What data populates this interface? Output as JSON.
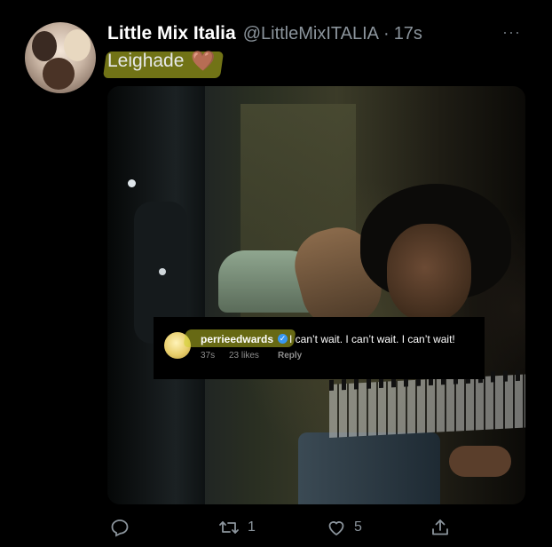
{
  "tweet": {
    "display_name": "Little Mix Italia",
    "handle": "@LittleMixITALIA",
    "separator": "·",
    "time": "17s",
    "more_icon": "···",
    "text": "Leighade",
    "emoji": "🤎"
  },
  "media": {
    "comment": {
      "username": "perrieedwards",
      "verified_icon": "✓",
      "text": "I can’t wait. I can’t wait. I can’t wait!",
      "time": "37s",
      "likes": "23 likes",
      "reply_label": "Reply"
    }
  },
  "actions": {
    "reply_icon": "reply-icon",
    "retweet_count": "1",
    "like_count": "5",
    "share_icon": "share-icon"
  },
  "colors": {
    "background": "#000000",
    "highlight": "#cdd228",
    "muted": "#8b949c"
  }
}
